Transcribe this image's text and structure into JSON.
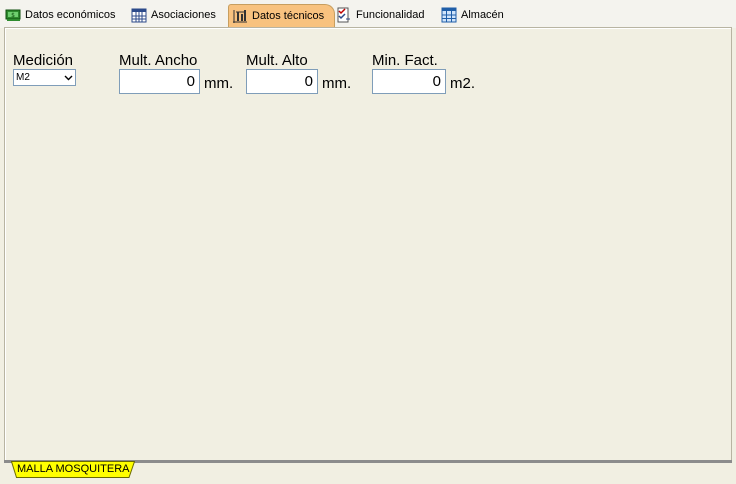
{
  "tabs": [
    {
      "label": "Datos económicos",
      "icon": "money-icon",
      "active": false
    },
    {
      "label": "Asociaciones",
      "icon": "calendar-grid-icon",
      "active": false
    },
    {
      "label": "Datos técnicos",
      "icon": "technical-sheet-icon",
      "active": true
    },
    {
      "label": "Funcionalidad",
      "icon": "checklist-icon",
      "active": false
    },
    {
      "label": "Almacén",
      "icon": "warehouse-grid-icon",
      "active": false
    }
  ],
  "form": {
    "medicion": {
      "label": "Medición",
      "value": "M2"
    },
    "mult_ancho": {
      "label": "Mult. Ancho",
      "value": "0",
      "unit": "mm."
    },
    "mult_alto": {
      "label": "Mult. Alto",
      "value": "0",
      "unit": "mm."
    },
    "min_fact": {
      "label": "Min. Fact.",
      "value": "0",
      "unit": "m2."
    }
  },
  "sheet_tab": {
    "label": "MALLA MOSQUITERA"
  },
  "colors": {
    "active_tab": "#f8c27f",
    "panel_bg": "#f1efe2",
    "sheet_tab": "#ffff00",
    "input_border": "#7f9db9"
  }
}
